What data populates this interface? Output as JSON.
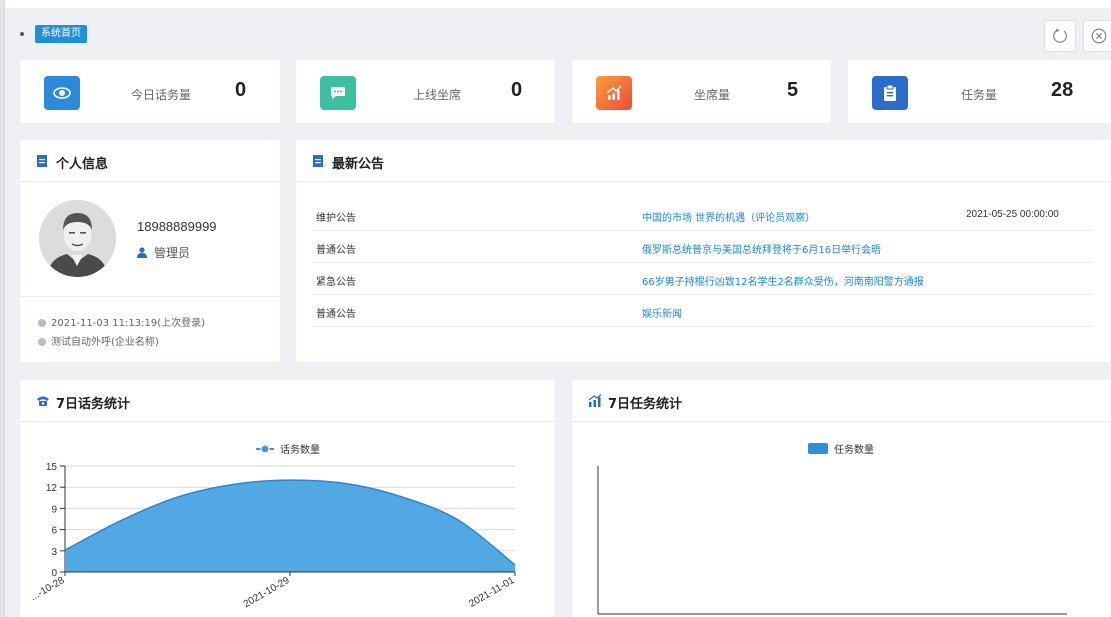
{
  "breadcrumb": {
    "label": "系统首页"
  },
  "toolbar": {
    "refresh_icon": "refresh-icon",
    "close_icon": "close-circle-icon"
  },
  "stats": [
    {
      "label": "今日话务量",
      "value": "0",
      "icon": "eye-icon",
      "color": "#2d8ad8"
    },
    {
      "label": "上线坐席",
      "value": "0",
      "icon": "chat-icon",
      "color": "#3cc0a4"
    },
    {
      "label": "坐席量",
      "value": "5",
      "icon": "chart-up-icon",
      "color": "#f0603a"
    },
    {
      "label": "任务量",
      "value": "28",
      "icon": "clipboard-icon",
      "color": "#2a6cc7"
    }
  ],
  "profile": {
    "title": "个人信息",
    "phone": "18988889999",
    "role": "管理员",
    "last_login": "2021-11-03 11:13:19(上次登录)",
    "company": "测试自动外呼(企业名称)"
  },
  "notices": {
    "title": "最新公告",
    "rows": [
      {
        "type": "维护公告",
        "title": "中国的市场 世界的机遇（评论员观察）",
        "date": "2021-05-25 00:00:00"
      },
      {
        "type": "普通公告",
        "title": "俄罗斯总统普京与美国总统拜登将于6月16日举行会晤",
        "date": ""
      },
      {
        "type": "紧急公告",
        "title": "66岁男子持棍行凶致12名学生2名群众受伤，河南南阳警方通报",
        "date": ""
      },
      {
        "type": "普通公告",
        "title": "娱乐新闻",
        "date": ""
      }
    ]
  },
  "calls_panel": {
    "title": "7日话务统计"
  },
  "tasks_panel": {
    "title": "7日任务统计"
  },
  "chart_data": [
    {
      "type": "area",
      "title": "",
      "legend": "top-center",
      "series": [
        {
          "name": "话务数量",
          "color": "#3b98dc"
        }
      ],
      "x": [
        "2021-10-28",
        "2021-10-29",
        "2021-11-01"
      ],
      "x_tick_labels": [
        "...-10-28",
        "2021-10-29",
        "2021-11-01"
      ],
      "x_samples": [
        0,
        0.125,
        0.25,
        0.375,
        0.5,
        0.625,
        0.75,
        0.875,
        1
      ],
      "y_samples": [
        3.1,
        7.3,
        10.6,
        12.4,
        13.0,
        12.5,
        10.6,
        7.3,
        1.0
      ],
      "ylim": [
        0,
        15
      ],
      "yticks": [
        0,
        3,
        6,
        9,
        12,
        15
      ],
      "grid": true
    },
    {
      "type": "bar",
      "title": "",
      "legend": "top-center",
      "series": [
        {
          "name": "任务数量",
          "color": "#2e8fd8",
          "values": []
        }
      ],
      "categories": []
    }
  ]
}
